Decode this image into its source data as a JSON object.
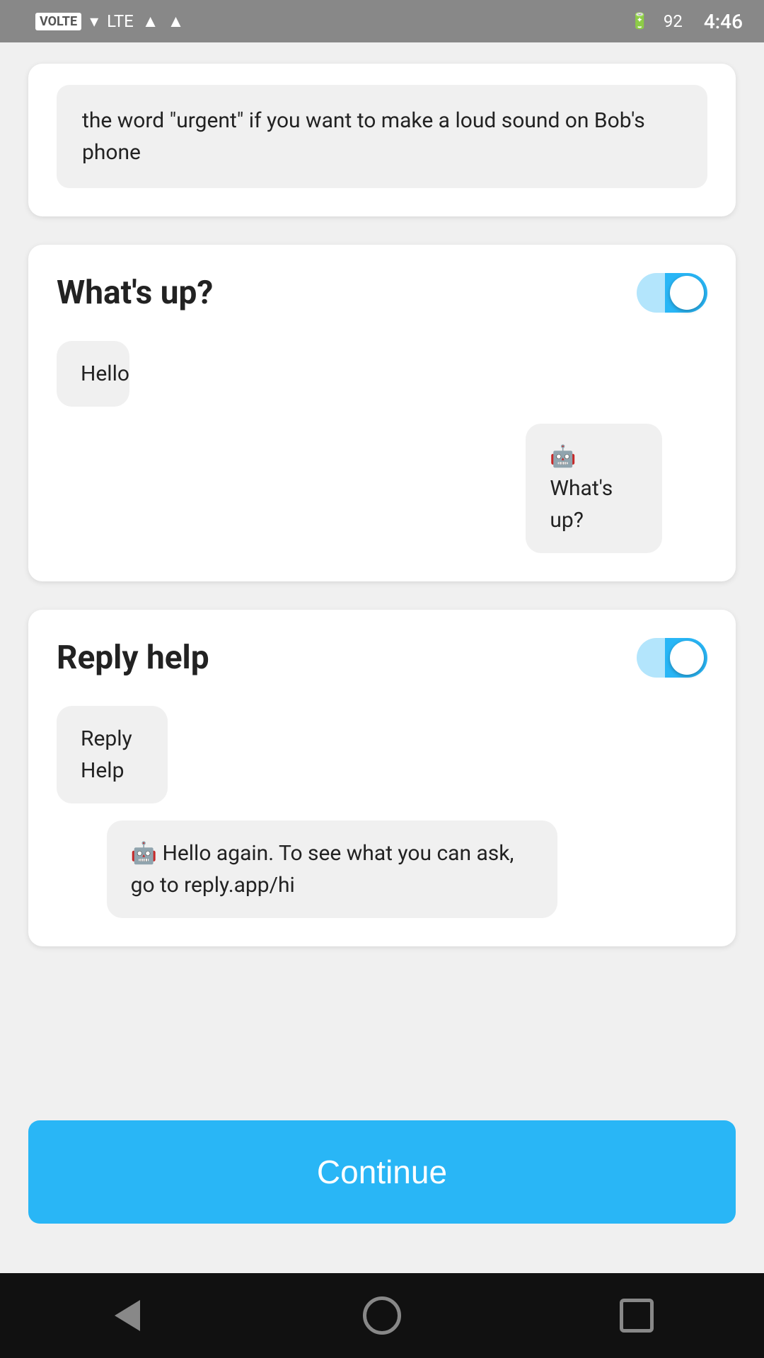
{
  "statusBar": {
    "volte": "VOLTE",
    "time": "4:46",
    "battery": "92"
  },
  "cards": [
    {
      "id": "partial-card",
      "partial_text": "the word \"urgent\" if you want to make a loud sound on Bob's phone"
    },
    {
      "id": "whats-up-card",
      "title": "What's up?",
      "toggle_on": true,
      "bubbles": [
        {
          "side": "left",
          "text": "Hello"
        },
        {
          "side": "right",
          "text": "🤖 What's up?"
        }
      ]
    },
    {
      "id": "reply-help-card",
      "title": "Reply help",
      "toggle_on": true,
      "bubbles": [
        {
          "side": "left",
          "text": "Reply Help"
        },
        {
          "side": "right",
          "text": "🤖 Hello again. To see what you can ask, go to reply.app/hi"
        }
      ]
    }
  ],
  "continueButton": {
    "label": "Continue"
  },
  "bottomNav": {
    "back_label": "back",
    "home_label": "home",
    "recents_label": "recents"
  }
}
